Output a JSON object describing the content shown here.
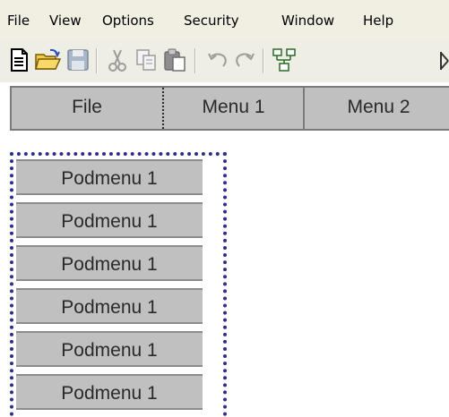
{
  "app_menu": {
    "items": [
      "File",
      "View",
      "Options",
      "Security",
      "Window",
      "Help"
    ]
  },
  "toolbar": {
    "buttons": [
      "new-document",
      "open-folder",
      "save",
      "cut",
      "copy",
      "paste",
      "undo",
      "redo",
      "network",
      "more"
    ]
  },
  "web_menu": {
    "items": [
      "File",
      "Menu 1",
      "Menu 2"
    ]
  },
  "submenu": {
    "items": [
      "Podmenu 1",
      "Podmenu 1",
      "Podmenu 1",
      "Podmenu 1",
      "Podmenu 1",
      "Podmenu 1"
    ]
  },
  "colors": {
    "menu_gray": "#c0c0c0",
    "dotted_frame": "#2d2d8c",
    "menubar_bg": "#f1efe2"
  }
}
